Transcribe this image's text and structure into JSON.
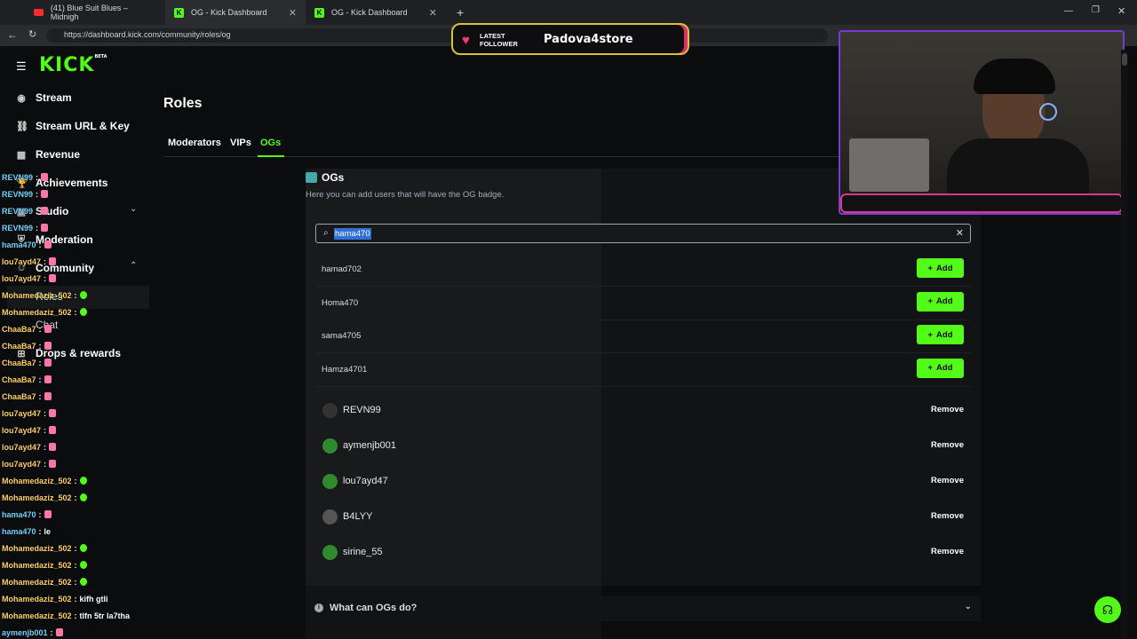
{
  "browser": {
    "tabs": [
      {
        "label": "(41) Blue Suit Blues – Midnigh"
      },
      {
        "label": "OG - Kick Dashboard"
      },
      {
        "label": "OG - Kick Dashboard"
      }
    ],
    "url": "https://dashboard.kick.com/community/roles/og"
  },
  "sidebar": {
    "brand": "KICK",
    "brand_badge": "BETA",
    "items": [
      {
        "label": "Stream"
      },
      {
        "label": "Stream URL & Key"
      },
      {
        "label": "Revenue"
      },
      {
        "label": "Achievements"
      },
      {
        "label": "Studio"
      },
      {
        "label": "Moderation"
      },
      {
        "label": "Community"
      },
      {
        "label": "Roles"
      },
      {
        "label": "Chat"
      },
      {
        "label": "Drops & rewards"
      }
    ]
  },
  "chat": [
    {
      "user": "REVN99",
      "msg": ""
    },
    {
      "user": "REVN99",
      "msg": ""
    },
    {
      "user": "REVN99",
      "msg": ""
    },
    {
      "user": "REVN99",
      "msg": ""
    },
    {
      "user": "hama470",
      "msg": ""
    },
    {
      "user": "lou7ayd47",
      "msg": ""
    },
    {
      "user": "lou7ayd47",
      "msg": ""
    },
    {
      "user": "Mohamedaziz_502",
      "msg": ""
    },
    {
      "user": "Mohamedaziz_502",
      "msg": ""
    },
    {
      "user": "ChaaBa7",
      "msg": ""
    },
    {
      "user": "ChaaBa7",
      "msg": ""
    },
    {
      "user": "ChaaBa7",
      "msg": ""
    },
    {
      "user": "ChaaBa7",
      "msg": ""
    },
    {
      "user": "ChaaBa7",
      "msg": ""
    },
    {
      "user": "lou7ayd47",
      "msg": ""
    },
    {
      "user": "lou7ayd47",
      "msg": ""
    },
    {
      "user": "lou7ayd47",
      "msg": ""
    },
    {
      "user": "lou7ayd47",
      "msg": ""
    },
    {
      "user": "Mohamedaziz_502",
      "msg": ""
    },
    {
      "user": "Mohamedaziz_502",
      "msg": ""
    },
    {
      "user": "hama470",
      "msg": ""
    },
    {
      "user": "hama470",
      "msg": "le"
    },
    {
      "user": "Mohamedaziz_502",
      "msg": ""
    },
    {
      "user": "Mohamedaziz_502",
      "msg": ""
    },
    {
      "user": "Mohamedaziz_502",
      "msg": ""
    },
    {
      "user": "Mohamedaziz_502",
      "msg": "kifh gtli"
    },
    {
      "user": "Mohamedaziz_502",
      "msg": "tlfn 5tr la7tha"
    },
    {
      "user": "aymenjb001",
      "msg": ""
    }
  ],
  "page": {
    "title": "Roles",
    "tabs": [
      {
        "label": "Moderators"
      },
      {
        "label": "VIPs"
      },
      {
        "label": "OGs"
      }
    ],
    "section_title": "OGs",
    "section_desc": "Here you can add users that will have the OG badge.",
    "search_value": "hama470",
    "results": [
      {
        "name": "hamad702",
        "action": "Add"
      },
      {
        "name": "Homa470",
        "action": "Add"
      },
      {
        "name": "sama4705",
        "action": "Add"
      },
      {
        "name": "Hamza4701",
        "action": "Add"
      }
    ],
    "members": [
      {
        "name": "REVN99",
        "action": "Remove"
      },
      {
        "name": "aymenjb001",
        "action": "Remove"
      },
      {
        "name": "lou7ayd47",
        "action": "Remove"
      },
      {
        "name": "B4LYY",
        "action": "Remove"
      },
      {
        "name": "sirine_55",
        "action": "Remove"
      }
    ],
    "faq": "What can OGs do?"
  },
  "overlay": {
    "follower_label_1": "LATEST",
    "follower_label_2": "FOLLOWER",
    "follower_name": "Padova4store"
  },
  "colors": {
    "accent": "#53fc18",
    "background": "#0b0c0d",
    "panel": "#121314"
  }
}
